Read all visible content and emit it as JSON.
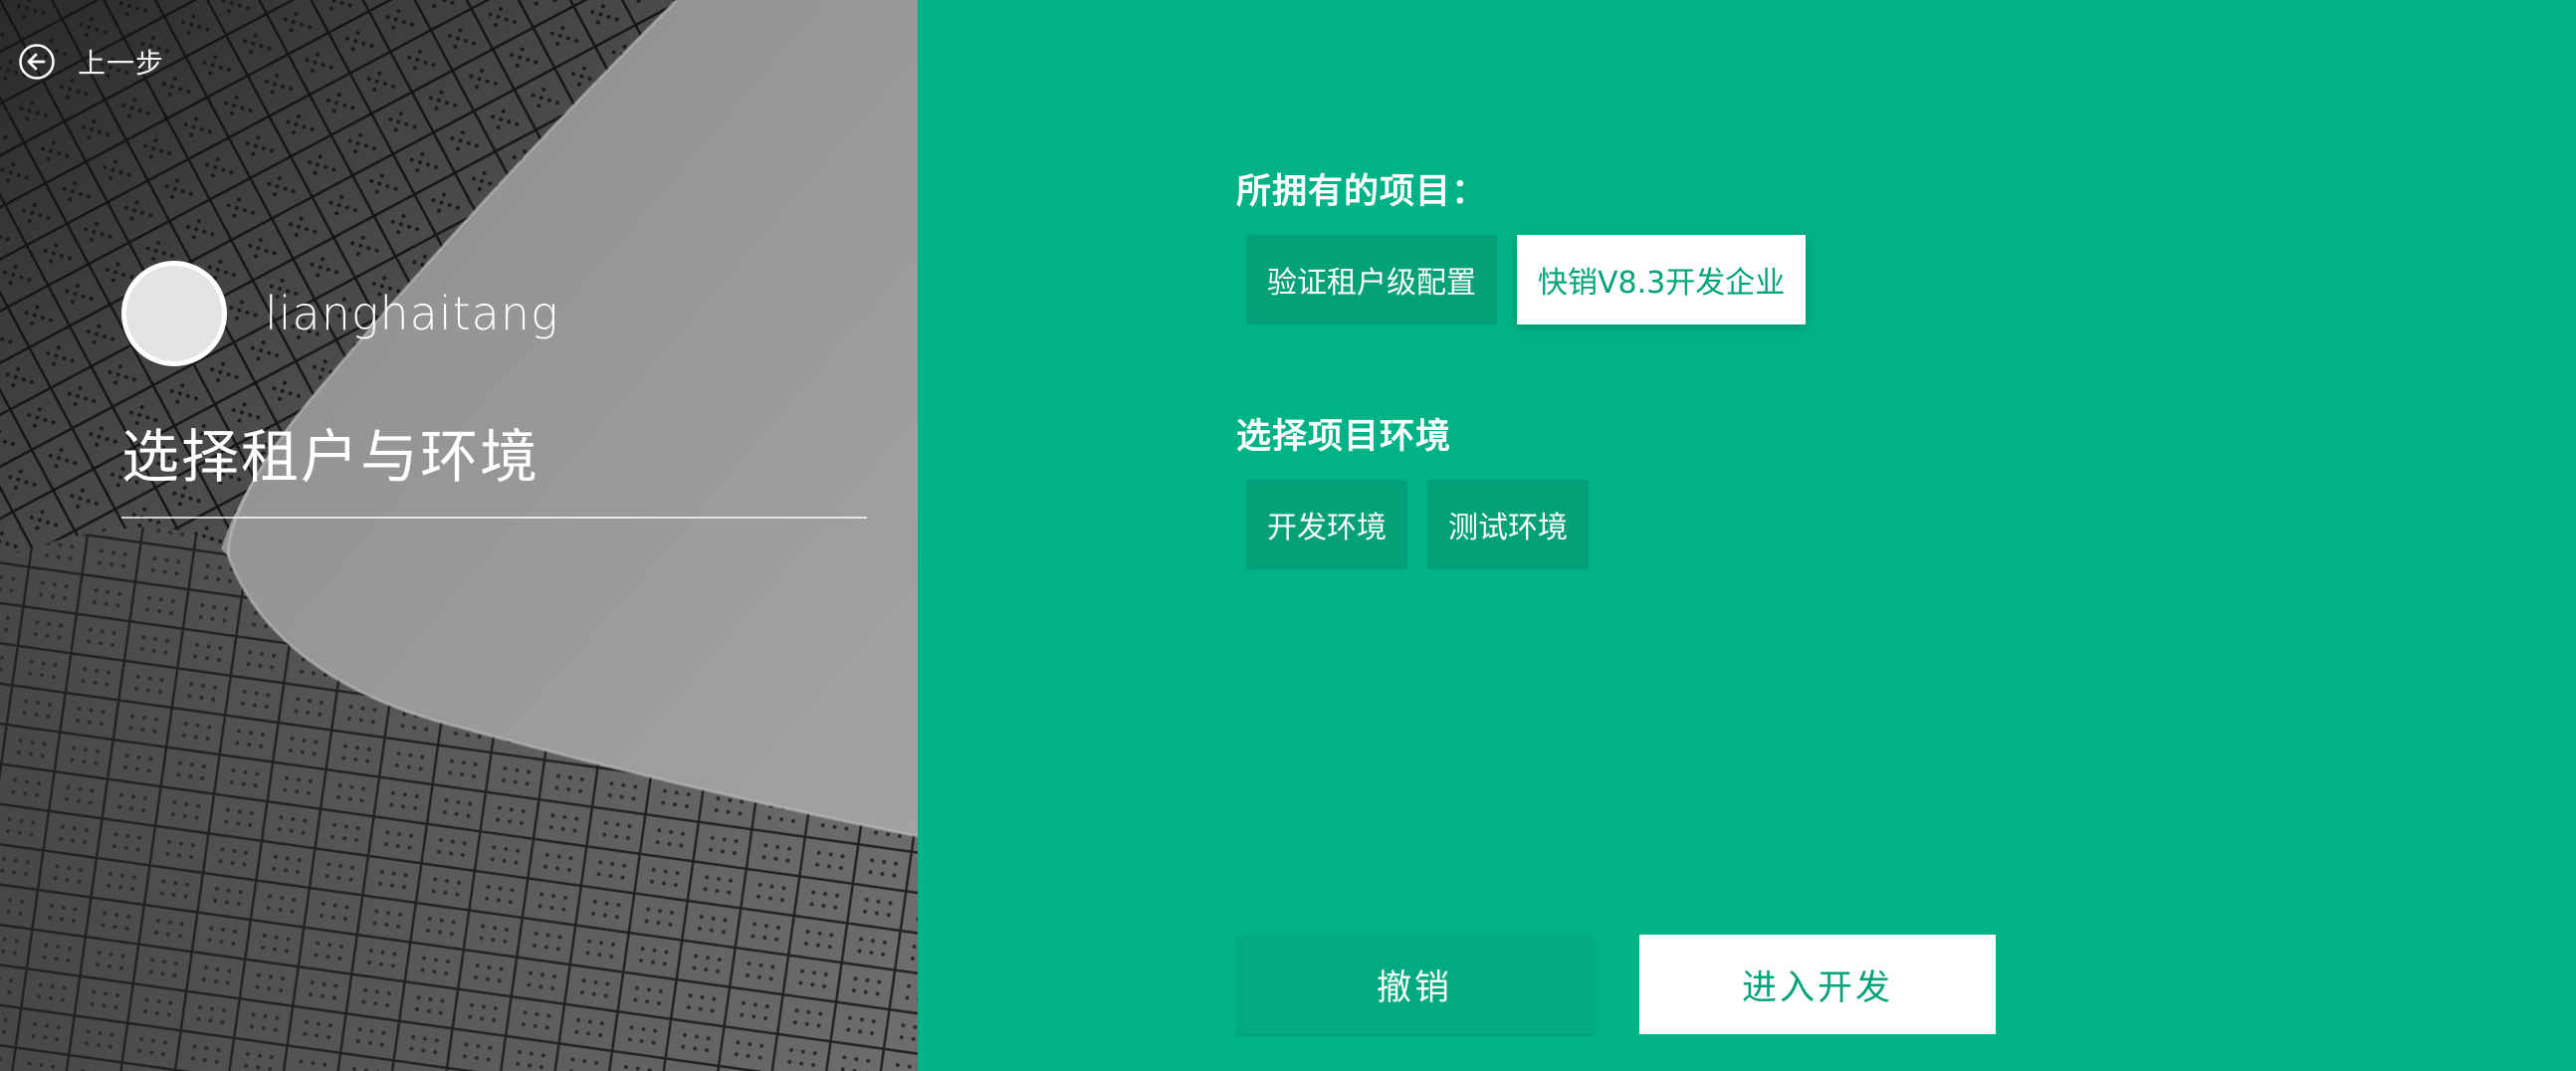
{
  "nav": {
    "back_label": "上一步",
    "back_icon": "arrow-left-circle-icon"
  },
  "user": {
    "username": "lianghaitang"
  },
  "page": {
    "title": "选择租户与环境"
  },
  "projects": {
    "label": "所拥有的项目：",
    "items": [
      {
        "label": "验证租户级配置",
        "selected": false
      },
      {
        "label": "快销V8.3开发企业",
        "selected": true
      }
    ]
  },
  "environments": {
    "label": "选择项目环境",
    "items": [
      {
        "label": "开发环境",
        "selected": false
      },
      {
        "label": "测试环境",
        "selected": false
      }
    ]
  },
  "actions": {
    "cancel_label": "撤销",
    "enter_label": "进入开发"
  },
  "colors": {
    "accent": "#00b386",
    "chip": "#02a178",
    "selected_text": "#00a27a"
  }
}
